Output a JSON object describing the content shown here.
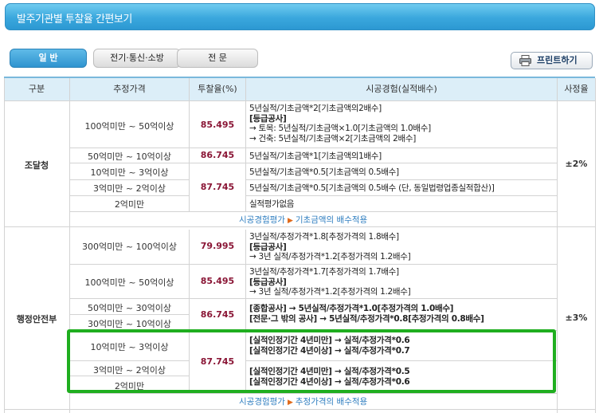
{
  "title": "발주기관별 투찰율 간편보기",
  "tabs": [
    {
      "label": "일 반",
      "active": true
    },
    {
      "label": "전기·통신·소방",
      "active": false
    },
    {
      "label": "전 문",
      "active": false
    }
  ],
  "print_label": "프린트하기",
  "headers": [
    "구분",
    "추정가격",
    "투찰율(%)",
    "시공경험(실적배수)",
    "사정율"
  ],
  "sections": [
    {
      "name": "조달청",
      "adjust": "±2%",
      "price_ranges": [
        "100억미만 ~ 50억이상",
        "50억미만 ~ 10억이상",
        "10억미만 ~ 3억이상",
        "3억미만 ~ 2억이상",
        "2억미만"
      ],
      "rates": [
        "85.495",
        "86.745",
        "87.745"
      ],
      "experience": [
        [
          "5년실적/기초금액*2[기초금액의2배수]",
          "[등급공사]",
          "→ 토목: 5년실적/기초금액×1.0[기초금액의 1.0배수]",
          "→ 건축: 5년실적/기초금액×2[기초금액의 2배수]"
        ],
        [
          "5년실적/기초금액*1[기초금액의1배수]"
        ],
        [
          "5년실적/기초금액*0.5[기초금액의 0.5배수]"
        ],
        [
          "5년실적/기초금액*0.5[기초금액의 0.5배수 (단, 동일법령업종실적합산)]"
        ],
        [
          "실적평가없음"
        ]
      ],
      "footer": {
        "left": "시공경험평가",
        "right": "기초금액의 배수적용"
      }
    },
    {
      "name": "행정안전부",
      "adjust": "±3%",
      "price_ranges": [
        "300억미만 ~ 100억이상",
        "100억미만 ~ 50억이상",
        "50억미만 ~ 30억이상",
        "30억미만 ~ 10억이상",
        "10억미만 ~ 3억이상",
        "3억미만 ~ 2억이상",
        "2억미만"
      ],
      "rates": [
        "79.995",
        "85.495",
        "86.745",
        "87.745"
      ],
      "experience": [
        [
          "3년실적/추정가격*1.8[추정가격의 1.8배수]",
          "[등급공사]",
          "→ 3년 실적/추정가격*1.2[추정가격의 1.2배수]"
        ],
        [
          "3년실적/추정가격*1.7[추정가격의 1.7배수]",
          "[등급공사]",
          "→ 3년 실적/추정가격*1.2[추정가격의 1.2배수]"
        ],
        [
          "[종합공사] → 5년실적/추정가격*1.0[추정가격의 1.0배수]",
          "[전문·그 밖의 공사] → 5년실적/추정가격*0.8[추정가격의 0.8배수]"
        ],
        [
          "[실적인정기간 4년미만] → 실적/추정가격*0.6",
          "[실적인정기간 4년이상] → 실적/추정가격*0.7"
        ],
        [
          "[실적인정기간 4년미만] → 실적/추정가격*0.5",
          "[실적인정기간 4년이상] → 실적/추정가격*0.6"
        ]
      ],
      "footer": {
        "left": "시공경험평가",
        "right": "추정가격의 배수적용"
      }
    }
  ],
  "colors": {
    "header_bg": "#dceef8",
    "rate_text": "#8a1636",
    "highlight_box": "#1fae1f",
    "title_bar": "#3aa7dd"
  }
}
